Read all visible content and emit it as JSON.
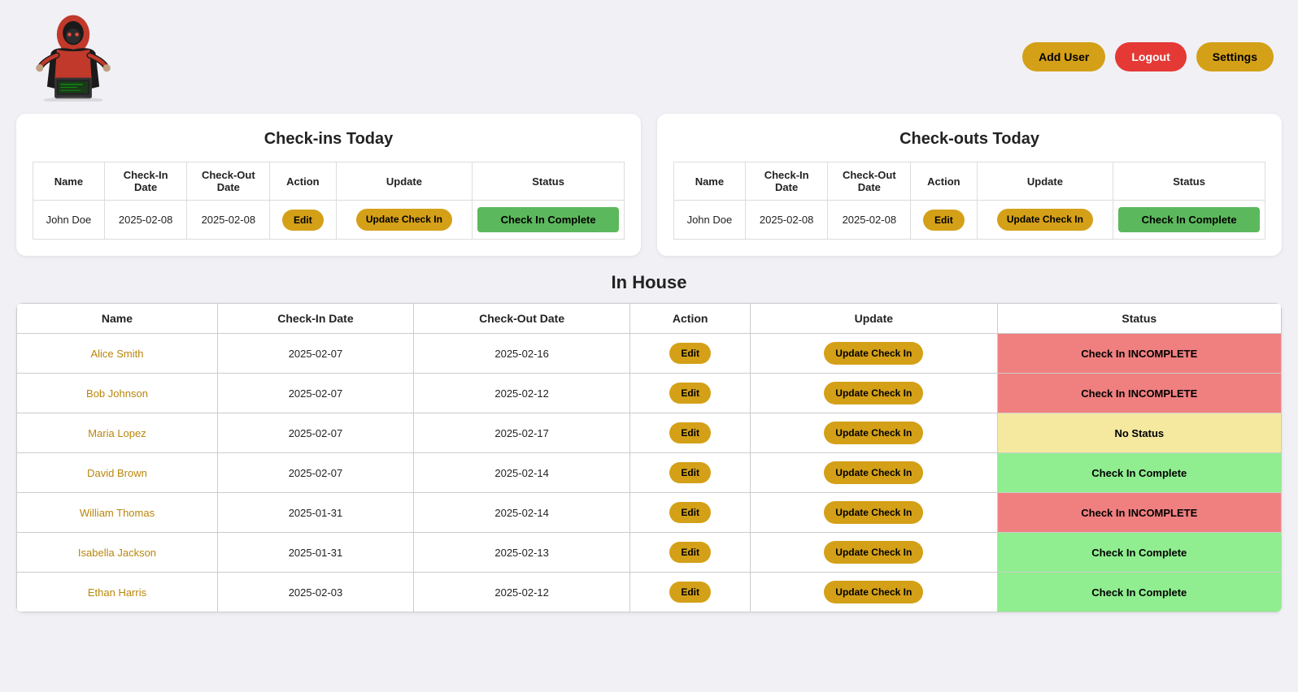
{
  "header": {
    "add_user_label": "Add User",
    "logout_label": "Logout",
    "settings_label": "Settings"
  },
  "checkins_today": {
    "title": "Check-ins Today",
    "columns": [
      "Name",
      "Check-In Date",
      "Check-Out Date",
      "Action",
      "Update",
      "Status"
    ],
    "rows": [
      {
        "name": "John Doe",
        "checkin": "2025-02-08",
        "checkout": "2025-02-08",
        "action": "Edit",
        "update": "Update Check In",
        "status": "Check In Complete"
      }
    ]
  },
  "checkouts_today": {
    "title": "Check-outs Today",
    "columns": [
      "Name",
      "Check-In Date",
      "Check-Out Date",
      "Action",
      "Update",
      "Status"
    ],
    "rows": [
      {
        "name": "John Doe",
        "checkin": "2025-02-08",
        "checkout": "2025-02-08",
        "action": "Edit",
        "update": "Update Check In",
        "status": "Check In Complete"
      }
    ]
  },
  "in_house": {
    "title": "In House",
    "columns": [
      "Name",
      "Check-In Date",
      "Check-Out Date",
      "Action",
      "Update",
      "Status"
    ],
    "rows": [
      {
        "name": "Alice Smith",
        "checkin": "2025-02-07",
        "checkout": "2025-02-16",
        "action": "Edit",
        "update": "Update Check In",
        "status": "Check In INCOMPLETE",
        "status_type": "incomplete"
      },
      {
        "name": "Bob Johnson",
        "checkin": "2025-02-07",
        "checkout": "2025-02-12",
        "action": "Edit",
        "update": "Update Check In",
        "status": "Check In INCOMPLETE",
        "status_type": "incomplete"
      },
      {
        "name": "Maria Lopez",
        "checkin": "2025-02-07",
        "checkout": "2025-02-17",
        "action": "Edit",
        "update": "Update Check In",
        "status": "No Status",
        "status_type": "no"
      },
      {
        "name": "David Brown",
        "checkin": "2025-02-07",
        "checkout": "2025-02-14",
        "action": "Edit",
        "update": "Update Check In",
        "status": "Check In Complete",
        "status_type": "complete"
      },
      {
        "name": "William Thomas",
        "checkin": "2025-01-31",
        "checkout": "2025-02-14",
        "action": "Edit",
        "update": "Update Check In",
        "status": "Check In INCOMPLETE",
        "status_type": "incomplete"
      },
      {
        "name": "Isabella Jackson",
        "checkin": "2025-01-31",
        "checkout": "2025-02-13",
        "action": "Edit",
        "update": "Update Check In",
        "status": "Check In Complete",
        "status_type": "complete"
      },
      {
        "name": "Ethan Harris",
        "checkin": "2025-02-03",
        "checkout": "2025-02-12",
        "action": "Edit",
        "update": "Update Check In",
        "status": "Check In Complete",
        "status_type": "complete"
      }
    ]
  }
}
